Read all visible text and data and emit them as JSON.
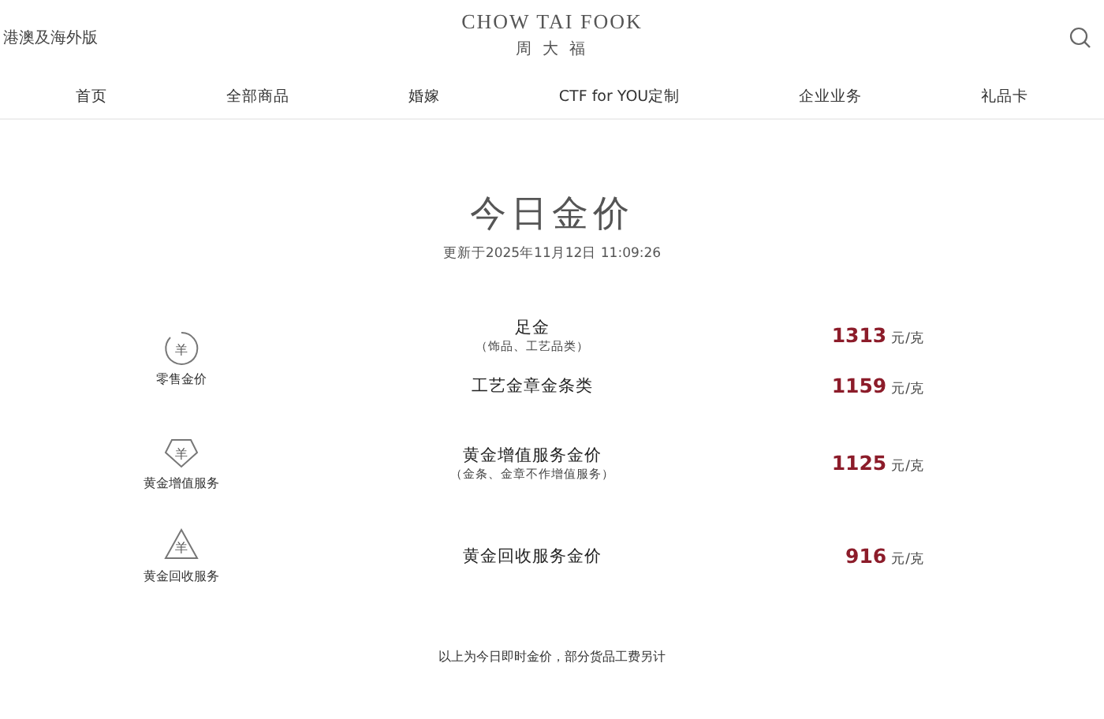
{
  "header": {
    "region_link": "港澳及海外版",
    "brand_en": "CHOW TAI FOOK",
    "brand_zh": "周 大 福"
  },
  "nav": [
    "首页",
    "全部商品",
    "婚嫁",
    "CTF for YOU定制",
    "企业业务",
    "礼品卡"
  ],
  "title": "今日金价",
  "updated": "更新于2025年11月12日 11:09:26",
  "groups": [
    {
      "kind": "circle",
      "symbol": "羊",
      "label": "零售金价",
      "items": [
        {
          "name": "足金",
          "note": "（饰品、工艺品类）",
          "price": "1313",
          "unit": "元/克"
        },
        {
          "name": "工艺金章金条类",
          "price": "1159",
          "unit": "元/克"
        }
      ]
    },
    {
      "kind": "diamond",
      "symbol": "羊",
      "label": "黄金增值服务",
      "items": [
        {
          "name": "黄金增值服务金价",
          "note": "（金条、金章不作增值服务）",
          "price": "1125",
          "unit": "元/克"
        }
      ]
    },
    {
      "kind": "recycle",
      "symbol": "羊",
      "label": "黄金回收服务",
      "items": [
        {
          "name": "黄金回收服务金价",
          "price": "916",
          "unit": "元/克"
        }
      ]
    }
  ],
  "footnote": "以上为今日即时金价，部分货品工费另计"
}
